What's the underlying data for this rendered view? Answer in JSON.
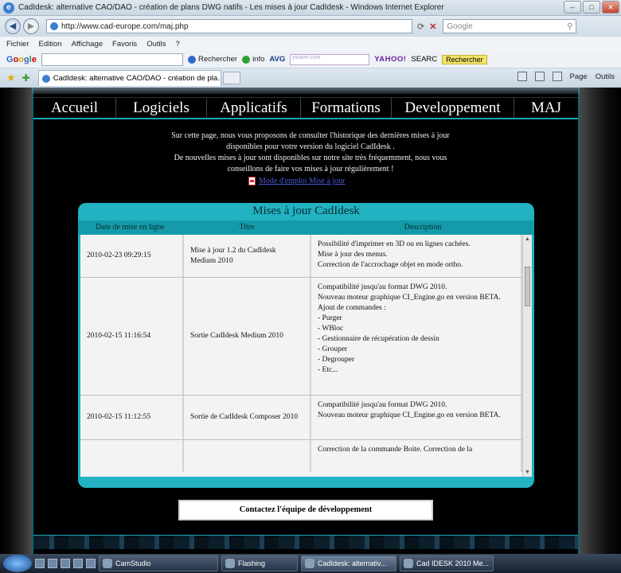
{
  "browser": {
    "window_title": "CadIdesk: alternative CAO/DAO - création de plans DWG natifs - Les mises à jour CadIdesk - Windows Internet Explorer",
    "url": "http://www.cad-europe.com/maj.php",
    "search_placeholder": "Google",
    "menu": [
      "Fichier",
      "Edition",
      "Affichage",
      "Favoris",
      "Outils",
      "?"
    ],
    "toolbar": {
      "google_search_label": "Rechercher",
      "info_label": "info",
      "avg_label": "AVG",
      "yahoo_label": "YAHOO!",
      "yahoo_box_text": "ywave.com",
      "yahoo_search_label": "SEARC",
      "rechercher_btn": "Rechercher"
    },
    "tab_title": "CadIdesk: alternative CAO/DAO - création de pla...",
    "command_bar": {
      "page_label": "Page",
      "tools_label": "Outils"
    }
  },
  "nav": [
    "Accueil",
    "Logiciels",
    "Applicatifs",
    "Formations",
    "Developpement",
    "MAJ"
  ],
  "intro": {
    "line1": "Sur cette page, nous vous proposons de consulter l'historique des dernières mises à jour",
    "line2": "disponibles pour votre version du logiciel CadIdesk .",
    "line3": "De nouvelles mises à jour sont disponibles sur notre site très fréquemment, nous vous",
    "line4": "conseillons de faire vos mises à jour régulièrement !",
    "guide_link": "Mode d'emploi Mise à jour"
  },
  "updates": {
    "title": "Mises à jour CadIdesk",
    "columns": [
      "Date de mise en ligne",
      "Titre",
      "Description"
    ],
    "rows": [
      {
        "date": "2010-02-23 09:29:15",
        "title": "Mise à jour 1.2 du CadIdesk Medium 2010",
        "description": [
          "Possibilité d'imprimer en 3D ou en lignes cachées.",
          "Mise à jour des menus.",
          "Correction de l'accrochage objet en mode ortho."
        ]
      },
      {
        "date": "2010-02-15 11:16:54",
        "title": "Sortie CadIdesk Medium 2010",
        "description": [
          "Compatibilité jusqu'au format DWG 2010.",
          "Nouveau moteur graphique CI_Engine.go en version BETA.",
          "Ajout de commandes :",
          "- Purger",
          "- WBloc",
          "- Gestionnaire de récupération de dessin",
          "- Grouper",
          "- Degrouper",
          "- Etc..."
        ]
      },
      {
        "date": "2010-02-15 11:12:55",
        "title": "Sortie de CadIdesk Composer 2010",
        "description": [
          "Compatibilité jusqu'au format DWG 2010.",
          "Nouveau moteur graphique CI_Engine.go en version BETA."
        ]
      },
      {
        "date": "",
        "title": "",
        "description": [
          "Correction de la commande Boite. Correction de la"
        ]
      }
    ]
  },
  "contact_button": "Contactez l'équipe de développement",
  "taskbar": {
    "items": [
      "CamStudio",
      "Flashing",
      "CadIdesk: alternativ...",
      "Cad IDESK 2010 Me..."
    ]
  }
}
